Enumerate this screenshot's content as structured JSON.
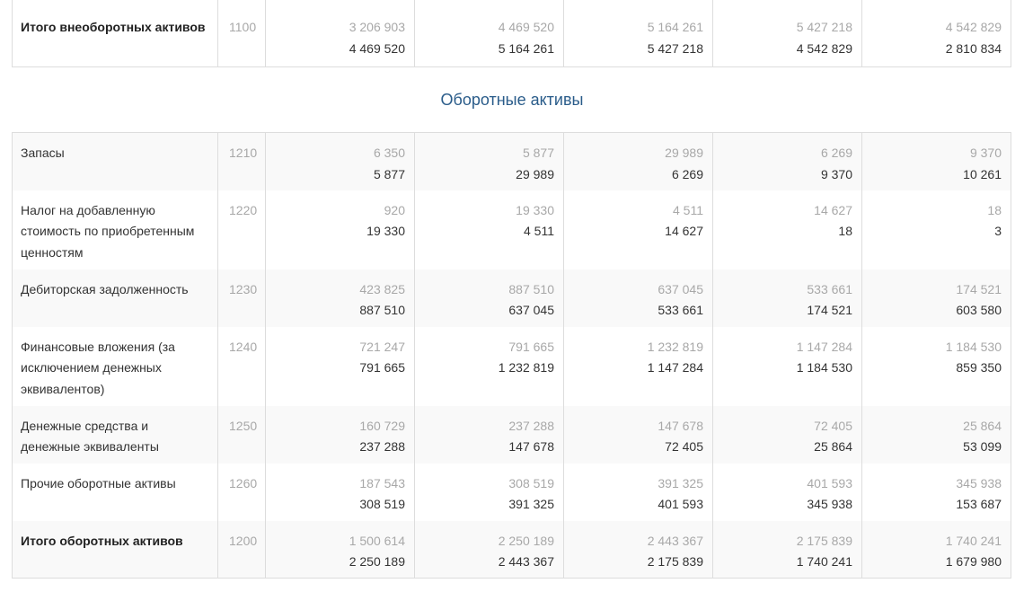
{
  "total_noncurrent": {
    "name": "Итого внеоборотных активов",
    "code": "1100",
    "values": [
      {
        "prev": "3 206 903",
        "cur": "4 469 520"
      },
      {
        "prev": "4 469 520",
        "cur": "5 164 261"
      },
      {
        "prev": "5 164 261",
        "cur": "5 427 218"
      },
      {
        "prev": "5 427 218",
        "cur": "4 542 829"
      },
      {
        "prev": "4 542 829",
        "cur": "2 810 834"
      }
    ]
  },
  "section_title": "Оборотные активы",
  "rows": [
    {
      "name": "Запасы",
      "code": "1210",
      "values": [
        {
          "prev": "6 350",
          "cur": "5 877"
        },
        {
          "prev": "5 877",
          "cur": "29 989"
        },
        {
          "prev": "29 989",
          "cur": "6 269"
        },
        {
          "prev": "6 269",
          "cur": "9 370"
        },
        {
          "prev": "9 370",
          "cur": "10 261"
        }
      ]
    },
    {
      "name": "Налог на добавленную стоимость по приобретенным ценностям",
      "code": "1220",
      "values": [
        {
          "prev": "920",
          "cur": "19 330"
        },
        {
          "prev": "19 330",
          "cur": "4 511"
        },
        {
          "prev": "4 511",
          "cur": "14 627"
        },
        {
          "prev": "14 627",
          "cur": "18"
        },
        {
          "prev": "18",
          "cur": "3"
        }
      ]
    },
    {
      "name": "Дебиторская задолженность",
      "code": "1230",
      "values": [
        {
          "prev": "423 825",
          "cur": "887 510"
        },
        {
          "prev": "887 510",
          "cur": "637 045"
        },
        {
          "prev": "637 045",
          "cur": "533 661"
        },
        {
          "prev": "533 661",
          "cur": "174 521"
        },
        {
          "prev": "174 521",
          "cur": "603 580"
        }
      ]
    },
    {
      "name": "Финансовые вложения (за исключением денежных эквивалентов)",
      "code": "1240",
      "values": [
        {
          "prev": "721 247",
          "cur": "791 665"
        },
        {
          "prev": "791 665",
          "cur": "1 232 819"
        },
        {
          "prev": "1 232 819",
          "cur": "1 147 284"
        },
        {
          "prev": "1 147 284",
          "cur": "1 184 530"
        },
        {
          "prev": "1 184 530",
          "cur": "859 350"
        }
      ]
    },
    {
      "name": "Денежные средства и денежные эквиваленты",
      "code": "1250",
      "values": [
        {
          "prev": "160 729",
          "cur": "237 288"
        },
        {
          "prev": "237 288",
          "cur": "147 678"
        },
        {
          "prev": "147 678",
          "cur": "72 405"
        },
        {
          "prev": "72 405",
          "cur": "25 864"
        },
        {
          "prev": "25 864",
          "cur": "53 099"
        }
      ]
    },
    {
      "name": "Прочие оборотные активы",
      "code": "1260",
      "values": [
        {
          "prev": "187 543",
          "cur": "308 519"
        },
        {
          "prev": "308 519",
          "cur": "391 325"
        },
        {
          "prev": "391 325",
          "cur": "401 593"
        },
        {
          "prev": "401 593",
          "cur": "345 938"
        },
        {
          "prev": "345 938",
          "cur": "153 687"
        }
      ]
    },
    {
      "name": "Итого оборотных активов",
      "code": "1200",
      "bold": true,
      "values": [
        {
          "prev": "1 500 614",
          "cur": "2 250 189"
        },
        {
          "prev": "2 250 189",
          "cur": "2 443 367"
        },
        {
          "prev": "2 443 367",
          "cur": "2 175 839"
        },
        {
          "prev": "2 175 839",
          "cur": "1 740 241"
        },
        {
          "prev": "1 740 241",
          "cur": "1 679 980"
        }
      ]
    }
  ]
}
